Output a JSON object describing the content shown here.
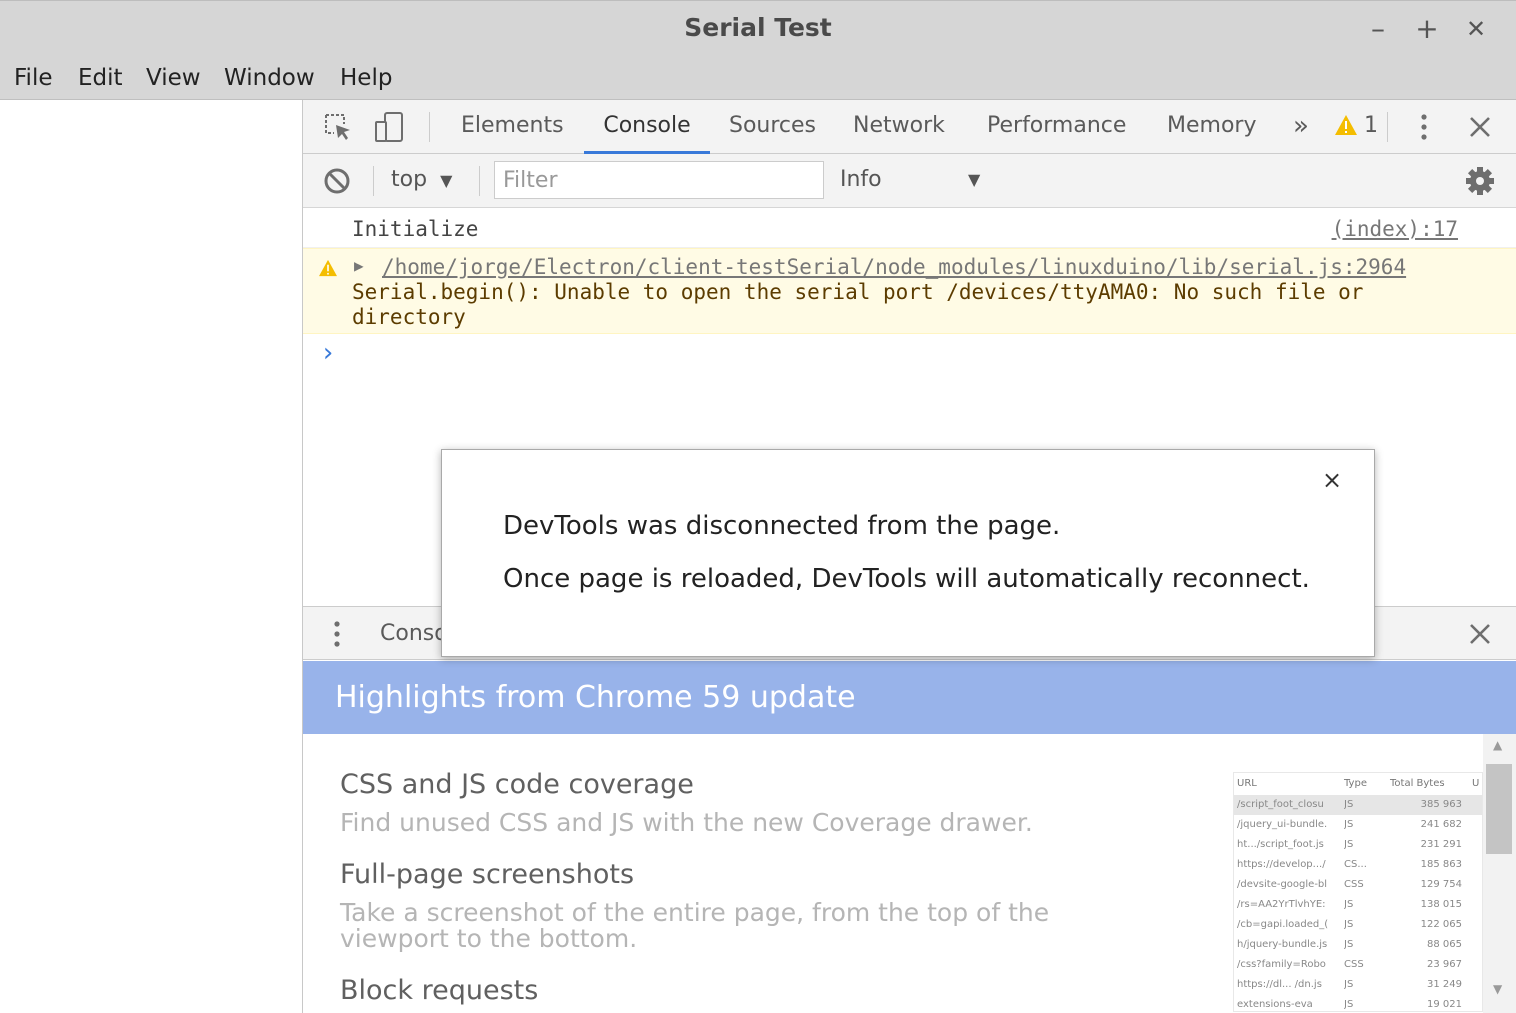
{
  "window": {
    "title": "Serial Test",
    "minimize": "–",
    "maximize": "+",
    "close": "✕"
  },
  "menu": [
    "File",
    "Edit",
    "View",
    "Window",
    "Help"
  ],
  "devtools": {
    "tabs": [
      "Elements",
      "Console",
      "Sources",
      "Network",
      "Performance",
      "Memory"
    ],
    "active_tab": "Console",
    "more_tabs": "»",
    "warning_count": "1",
    "toolbar": {
      "context": "top",
      "filter_placeholder": "Filter",
      "level": "Info"
    },
    "console": {
      "info_message": "Initialize",
      "info_source": "(index):17",
      "warn_path": "/home/jorge/Electron/client-testSerial/node_modules/linuxduino/lib/serial.js:2964",
      "warn_line1": "Serial.begin(): Unable to open the serial port /devices/ttyAMA0: No such file or",
      "warn_line2": "directory",
      "prompt": "›"
    },
    "drawer": {
      "tab_label": "Conso",
      "banner": "Highlights from Chrome 59 update",
      "features": [
        {
          "title": "CSS and JS code coverage",
          "desc": "Find unused CSS and JS with the new Coverage drawer."
        },
        {
          "title": "Full-page screenshots",
          "desc": "Take a screenshot of the entire page, from the top of the viewport to the bottom."
        },
        {
          "title": "Block requests",
          "desc": ""
        }
      ],
      "thumb_headers": [
        "URL",
        "Type",
        "Total Bytes",
        "U"
      ],
      "thumb_rows": [
        [
          "/script_foot_closu",
          "JS",
          "385 963"
        ],
        [
          "/jquery_ui-bundle.",
          "JS",
          "241 682"
        ],
        [
          "ht.../script_foot.js",
          "JS",
          "231 291"
        ],
        [
          "https://develop.../",
          "CS...",
          "185 863"
        ],
        [
          "/devsite-google-bl",
          "CSS",
          "129 754"
        ],
        [
          "/rs=AA2YrTlvhYE:",
          "JS",
          "138 015"
        ],
        [
          "/cb=gapi.loaded_(",
          "JS",
          "122 065"
        ],
        [
          "h/jquery-bundle.js",
          "JS",
          "88 065"
        ],
        [
          "/css?family=Robo",
          "CSS",
          "23 967"
        ],
        [
          "https://dl... /dn.js",
          "JS",
          "31 249"
        ],
        [
          "extensions-eva",
          "JS",
          "19 021"
        ]
      ]
    },
    "modal": {
      "line1": "DevTools was disconnected from the page.",
      "line2": "Once page is reloaded, DevTools will automatically reconnect.",
      "close": "×"
    }
  },
  "colors": {
    "accent": "#3879d9",
    "banner": "#98b3ea",
    "warning_bg": "#fffbe5",
    "warning_icon": "#f4bd00"
  }
}
